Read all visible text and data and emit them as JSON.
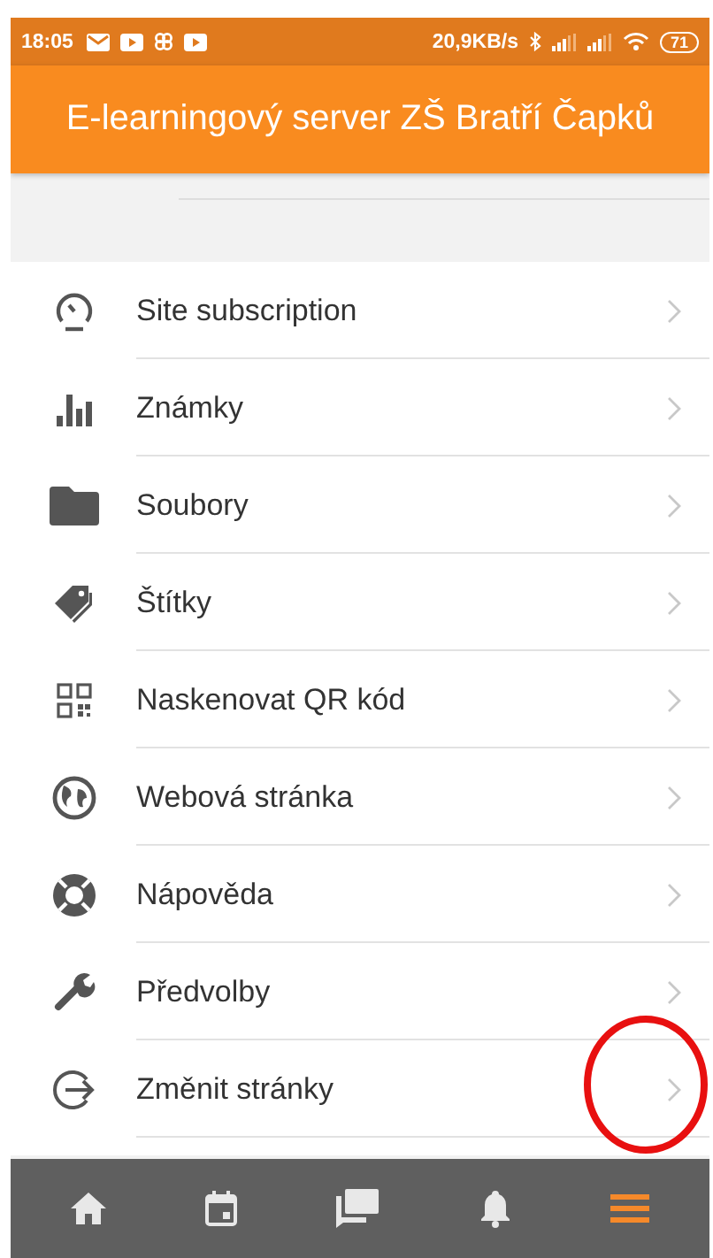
{
  "status_bar": {
    "time": "18:05",
    "speed": "20,9KB/s",
    "battery": "71"
  },
  "header": {
    "title": "E-learningový server ZŠ Bratří Čapků"
  },
  "menu": [
    {
      "label": "Site subscription",
      "kind": "gauge"
    },
    {
      "label": "Známky",
      "kind": "bars"
    },
    {
      "label": "Soubory",
      "kind": "folder"
    },
    {
      "label": "Štítky",
      "kind": "tags"
    },
    {
      "label": "Naskenovat QR kód",
      "kind": "qr"
    },
    {
      "label": "Webová stránka",
      "kind": "globe"
    },
    {
      "label": "Nápověda",
      "kind": "lifebuoy"
    },
    {
      "label": "Předvolby",
      "kind": "wrench"
    },
    {
      "label": "Změnit stránky",
      "kind": "exit"
    }
  ],
  "bottom_nav": [
    {
      "kind": "home",
      "selected": false
    },
    {
      "kind": "calendar",
      "selected": false
    },
    {
      "kind": "chat",
      "selected": false
    },
    {
      "kind": "bell",
      "selected": false
    },
    {
      "kind": "menu",
      "selected": true
    }
  ]
}
